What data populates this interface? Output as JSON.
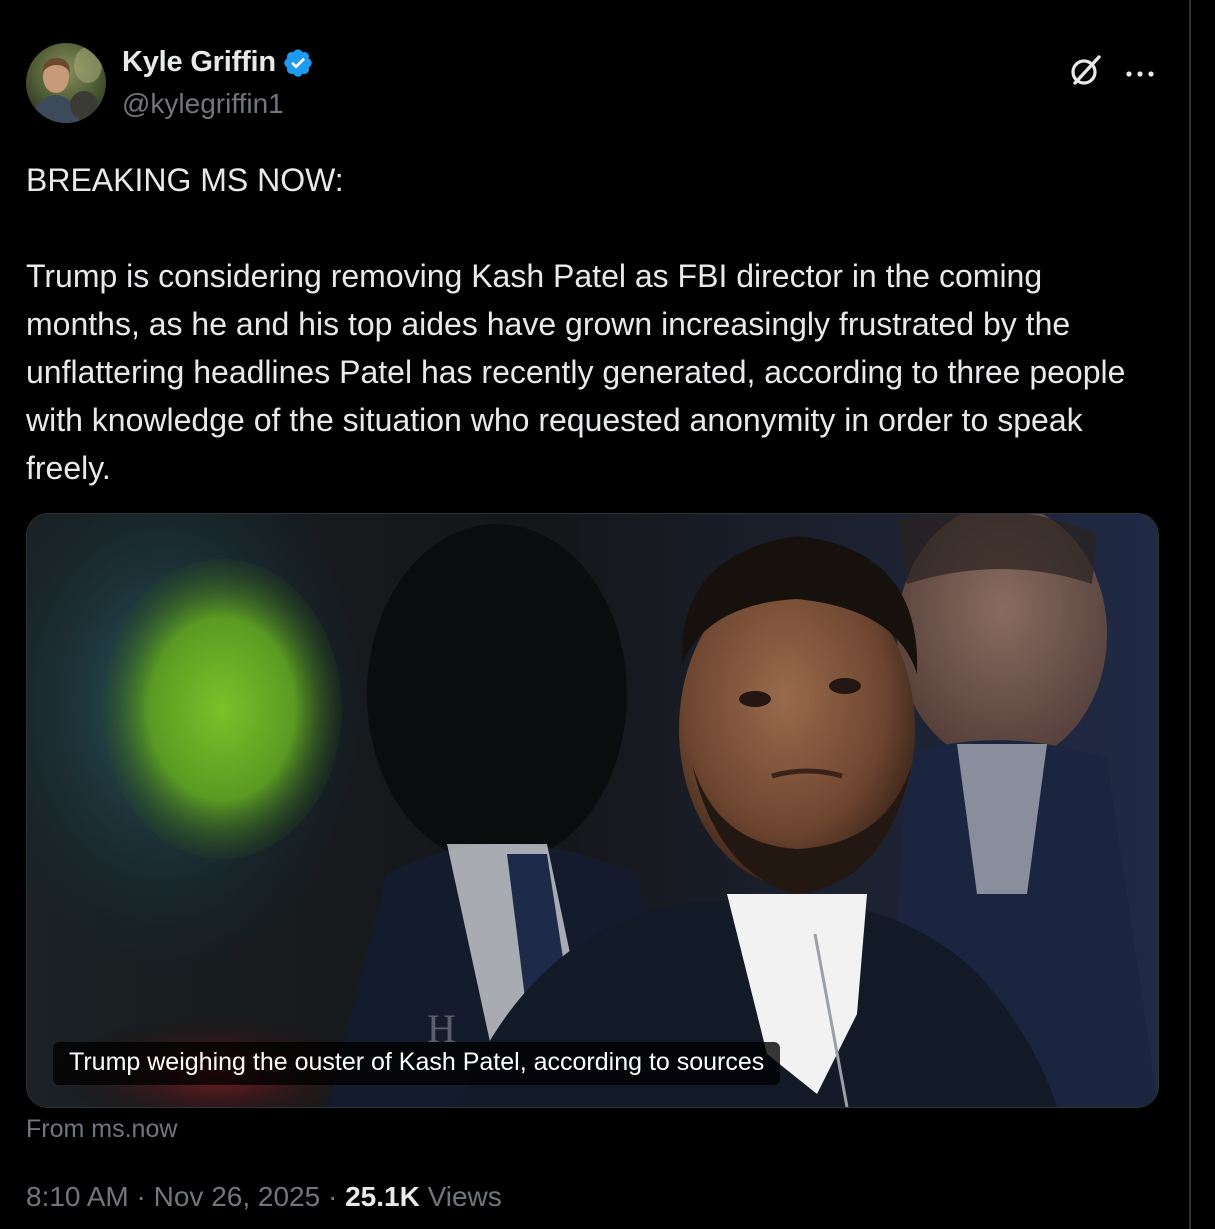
{
  "author": {
    "name": "Kyle Griffin",
    "handle": "@kylegriffin1",
    "verified": true
  },
  "tweet": {
    "headline": "BREAKING MS NOW:",
    "text": "Trump is considering removing Kash Patel as FBI director in the coming months, as he and his top aides have grown increasingly frustrated by the unflattering headlines Patel has recently generated, according to three people with knowledge of the situation who requested anonymity in order to speak freely."
  },
  "link_card": {
    "caption": "Trump weighing the ouster of Kash Patel, according to sources",
    "source": "From ms.now"
  },
  "meta": {
    "time": "8:10 AM",
    "separator": "·",
    "date": "Nov 26, 2025",
    "views_count": "25.1K",
    "views_label": "Views"
  },
  "icons": {
    "verified": "verified-badge-icon",
    "grok": "grok-icon",
    "more": "more-options-icon"
  },
  "colors": {
    "background": "#000000",
    "text": "#e7e9ea",
    "secondary": "#71767b",
    "verified": "#1d9bf0",
    "border": "#2f3336"
  }
}
